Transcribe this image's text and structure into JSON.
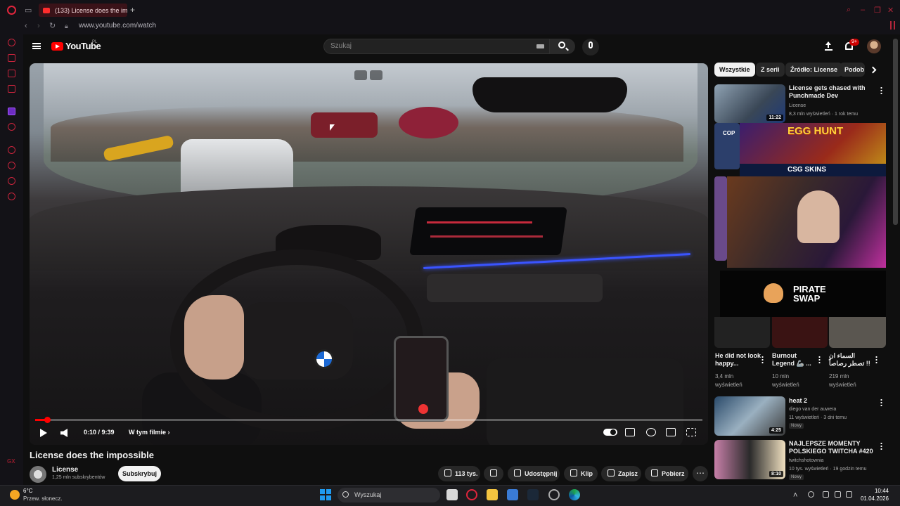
{
  "browser": {
    "tab_title": "(133) License does the imp",
    "new_tab": "+",
    "url": "www.youtube.com/watch",
    "sidebar_label": "GX"
  },
  "youtube": {
    "logo": "YouTube",
    "logo_region": "PL",
    "search_placeholder": "Szukaj",
    "notifications": "9+"
  },
  "player": {
    "time": "0:10 / 9:39",
    "chapter": "W tym filmie",
    "progress_fraction": 0.018
  },
  "video": {
    "title": "License does the impossible",
    "channel": "License",
    "subscribers": "1,25 mln subskrybentów",
    "subscribe_label": "Subskrybuj",
    "likes": "113 tys.",
    "share": "Udostępnij",
    "clip": "Klip",
    "save": "Zapisz",
    "download": "Pobierz"
  },
  "chips": [
    "Wszystkie",
    "Z serii",
    "Źródło: License",
    "Podob"
  ],
  "recommended": [
    {
      "title": "License gets chased with Punchmade Dev",
      "channel": "License",
      "meta": "8,3 mln wyświetleń · 1 rok temu",
      "duration": "11:22"
    },
    {
      "title": "heat 2",
      "channel": "diego van der auwera",
      "meta": "11 wyświetleń · 3 dni temu",
      "duration": "4:25",
      "badge": "Nowy"
    },
    {
      "title": "NAJLEPSZE MOMENTY POLSKIEGO TWITCHA #420",
      "channel": "twitchshotownia",
      "meta": "10 tys. wyświetleń · 19 godzin temu",
      "duration": "8:10",
      "badge": "Nowy"
    }
  ],
  "shorts": [
    {
      "title": "He did not look happy...",
      "views": "3,4 mln",
      "unit": "wyświetleń"
    },
    {
      "title": "Burnout Legend 🦾 ...",
      "views": "10 mln",
      "unit": "wyświetleń"
    },
    {
      "title": "السماء ان تصطر رصاصاً !!",
      "views": "219 mln",
      "unit": "wyświetleń"
    }
  ],
  "ads": {
    "egg_hunt": "EGG HUNT",
    "csgo_skins": "CSG SKINS",
    "pirate_swap": "PIRATE SWAP",
    "cop": "COP"
  },
  "taskbar": {
    "temp": "6°C",
    "weather": "Przew. słonecz.",
    "search": "Wyszukaj",
    "time": "10:44",
    "date": "01.04.2026"
  }
}
